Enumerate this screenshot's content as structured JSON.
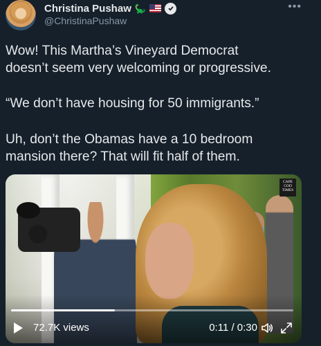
{
  "author": {
    "display_name": "Christina Pushaw",
    "handle": "@ChristinaPushaw",
    "name_badges": [
      "dinosaur-icon",
      "us-flag-icon",
      "verified-icon"
    ]
  },
  "tweet": {
    "lines_para1": [
      "Wow! This Martha’s Vineyard Democrat",
      "doesn’t seem very welcoming or progressive."
    ],
    "line_para2": "“We don’t have housing for 50 immigrants.”",
    "lines_para3": [
      "Uh, don’t the Obamas have a 10 bedroom",
      "mansion there? That will fit half of them."
    ]
  },
  "video": {
    "logo_lines": [
      "CAPE",
      "COD",
      "TIMES"
    ],
    "views": "72.7K views",
    "time": "0:11 / 0:30",
    "progress_fraction": 0.3667
  },
  "colors": {
    "background": "#15202b",
    "text": "#e7e9ea",
    "secondary": "#8b98a5"
  }
}
